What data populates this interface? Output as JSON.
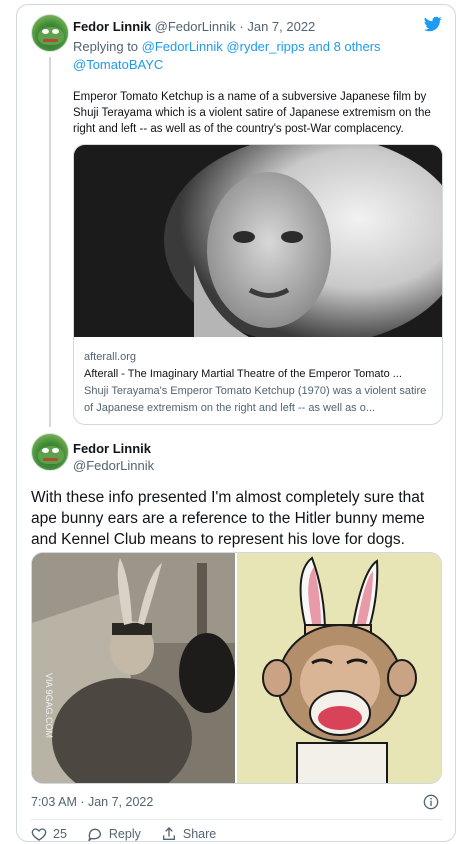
{
  "tweet1": {
    "display_name": "Fedor Linnik",
    "handle": "@FedorLinnik",
    "separator": "·",
    "date": "Jan 7, 2022",
    "replying_prefix": "Replying to",
    "reply_mention_1": "@FedorLinnik",
    "reply_mention_2": "@ryder_ripps",
    "reply_others": "and 8 others",
    "mention_line": "@TomatoBAYC",
    "text": "Emperor Tomato Ketchup is a name of a subversive Japanese film by Shuji Terayama which is a violent satire of Japanese extremism on the right and left -- as well as of the country's post-War complacency.",
    "card": {
      "domain": "afterall.org",
      "title": "Afterall - The Imaginary Martial Theatre of the Emperor Tomato ...",
      "description": "Shuji Terayama's Emperor Tomato Ketchup (1970) was a violent satire of Japanese extremism on the right and left -- as well as o..."
    }
  },
  "tweet2": {
    "display_name": "Fedor Linnik",
    "handle": "@FedorLinnik",
    "text": "With these info presented I'm almost completely sure that ape bunny ears are a reference to the Hitler bunny meme and Kennel Club means to represent his love for dogs.",
    "media_watermark": "VIA 9GAG.COM",
    "timestamp": "7:03 AM · Jan 7, 2022",
    "like_count": "25",
    "reply_label": "Reply",
    "share_label": "Share"
  },
  "icons": {
    "brand": "twitter-bird-icon",
    "info": "info-icon",
    "like": "heart-icon",
    "reply": "reply-bubble-icon",
    "share": "share-icon"
  },
  "colors": {
    "accent": "#1d9bf0",
    "text_secondary": "#536471",
    "border": "#cfd9de"
  }
}
